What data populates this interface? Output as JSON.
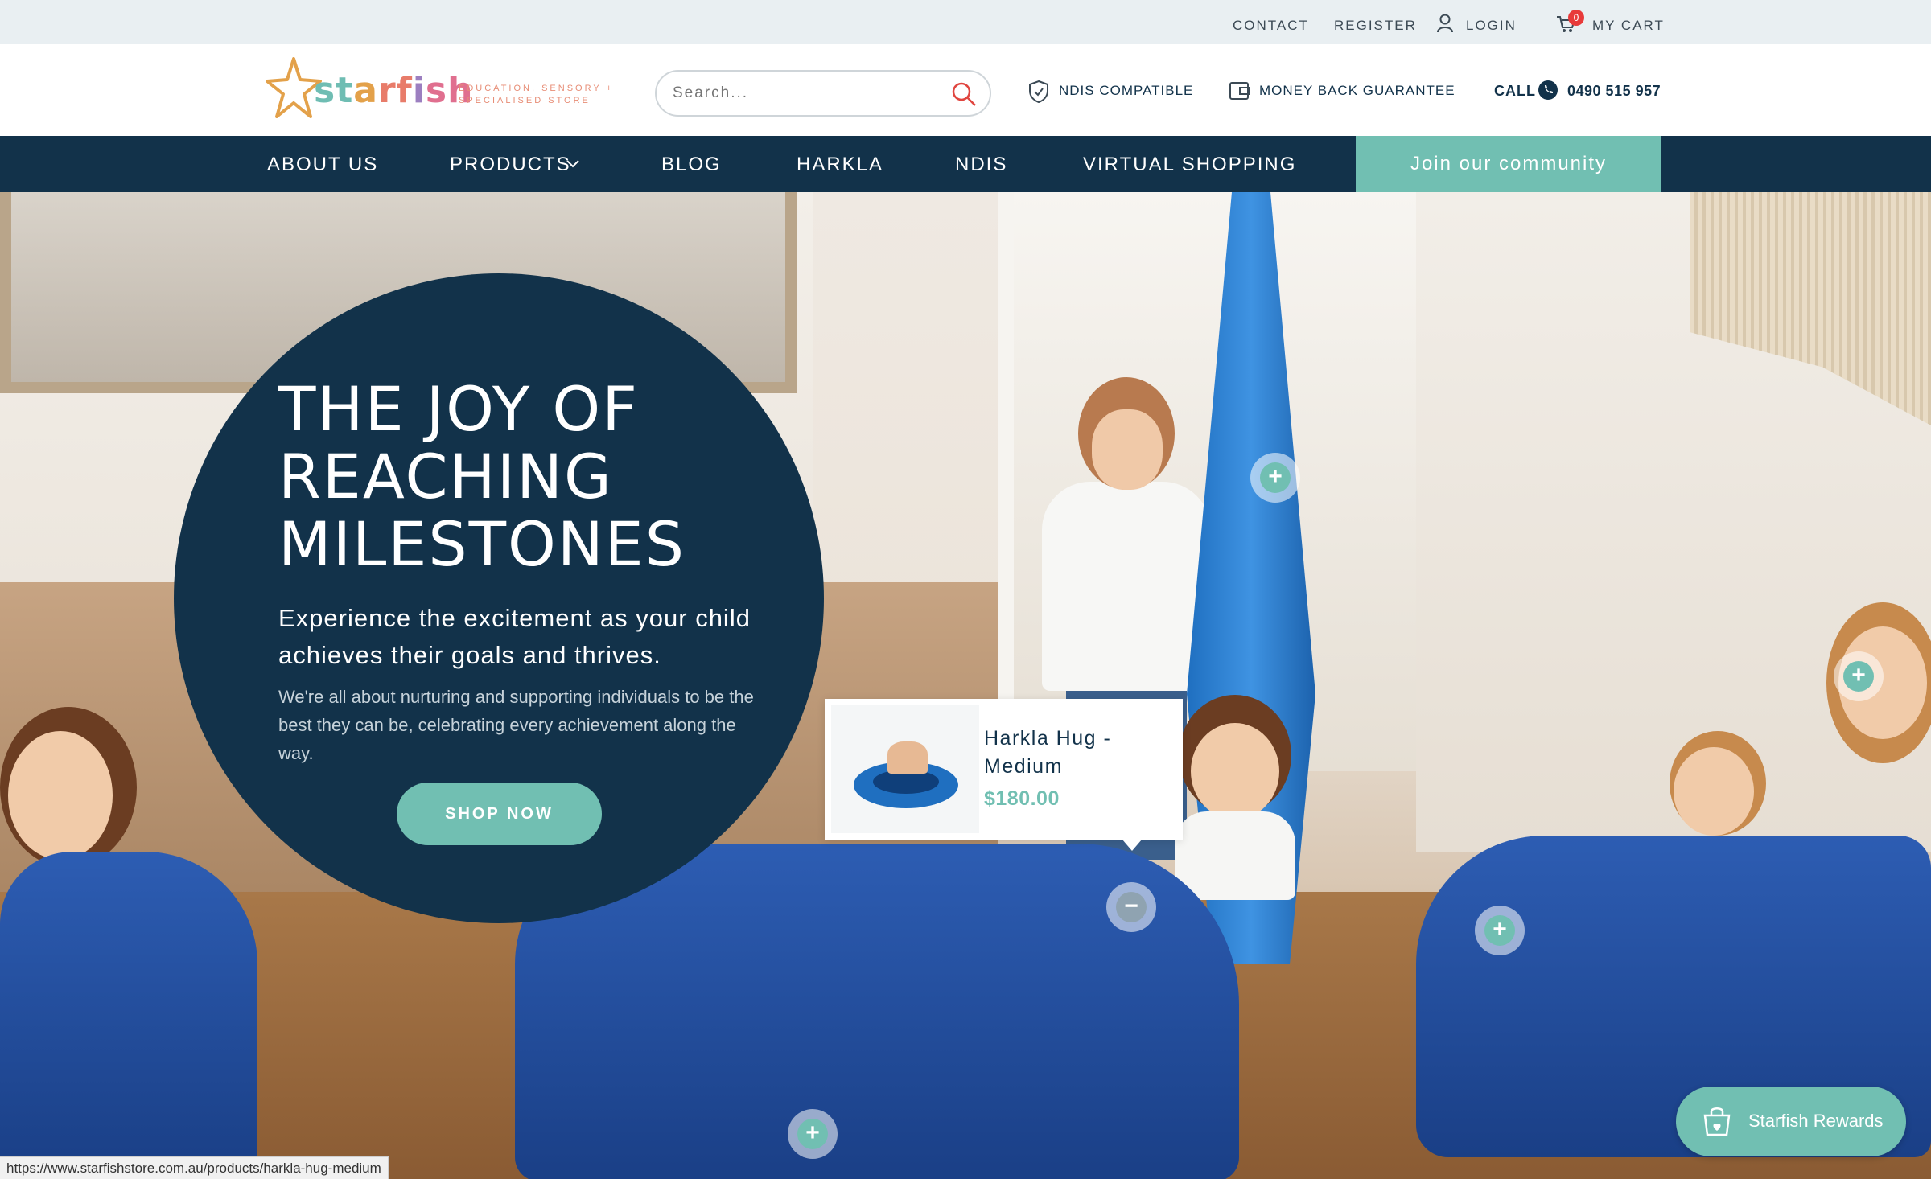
{
  "topbar": {
    "contact": "CONTACT",
    "register": "REGISTER",
    "login": "LOGIN",
    "cart": "MY CART",
    "cart_count": "0"
  },
  "header": {
    "logo_text": "starfish",
    "logo_tagline": "EDUCATION, SENSORY + SPECIALISED STORE",
    "search_placeholder": "Search...",
    "ndis": "NDIS COMPATIBLE",
    "guarantee": "MONEY BACK GUARANTEE",
    "call_label": "CALL",
    "phone": "0490 515 957"
  },
  "nav": {
    "items": [
      "ABOUT US",
      "PRODUCTS",
      "BLOG",
      "HARKLA",
      "NDIS",
      "Virtual Shopping"
    ],
    "cta": "Join our community"
  },
  "hero": {
    "title": "THE JOY OF reaching MILESTONES",
    "subtitle": "Experience the excitement as your child achieves their goals and thrives.",
    "body": "We're all about nurturing and supporting individuals to be the best they can be, celebrating every achievement along the way.",
    "button": "SHOP NOW"
  },
  "popup": {
    "product_name": "Harkla Hug - Medium",
    "price": "$180.00"
  },
  "rewards": {
    "label": "Starfish Rewards"
  },
  "status_url": "https://www.starfishstore.com.au/products/harkla-hug-medium",
  "colors": {
    "navy": "#12324a",
    "teal": "#71bfb2",
    "badge": "#e83a3a"
  }
}
